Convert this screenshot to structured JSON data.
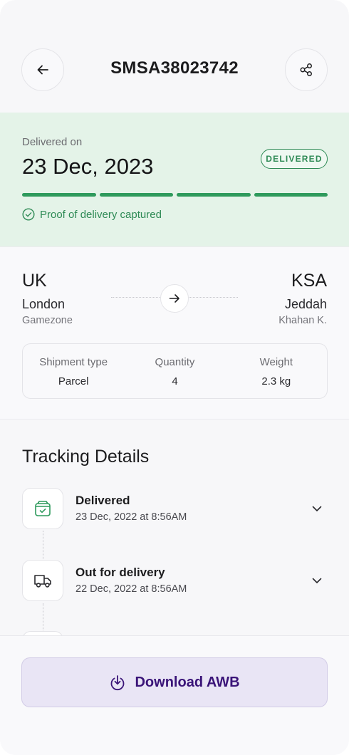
{
  "header": {
    "title": "SMSA38023742",
    "back_icon": "arrow-left-icon",
    "share_icon": "share-icon"
  },
  "delivery": {
    "label": "Delivered on",
    "date": "23 Dec, 2023",
    "status_badge": "DELIVERED",
    "progress_segments_complete": 4,
    "progress_segments_total": 4,
    "proof_text": "Proof of delivery captured",
    "accent_color": "#2e8a55",
    "card_bg": "#e4f3e8"
  },
  "route": {
    "origin": {
      "country": "UK",
      "city": "London",
      "company": "Gamezone"
    },
    "destination": {
      "country": "KSA",
      "city": "Jeddah",
      "company": "Khahan K."
    }
  },
  "shipment": {
    "type_label": "Shipment type",
    "type_value": "Parcel",
    "quantity_label": "Quantity",
    "quantity_value": "4",
    "weight_label": "Weight",
    "weight_value": "2.3 kg"
  },
  "tracking": {
    "title": "Tracking Details",
    "events": [
      {
        "name": "Delivered",
        "time": "23 Dec, 2022 at 8:56AM",
        "icon": "delivered-box-icon"
      },
      {
        "name": "Out for delivery",
        "time": "22 Dec, 2022 at 8:56AM",
        "icon": "truck-icon"
      }
    ]
  },
  "actions": {
    "download_label": "Download AWB",
    "download_icon": "download-icon",
    "download_color": "#3a1478"
  }
}
